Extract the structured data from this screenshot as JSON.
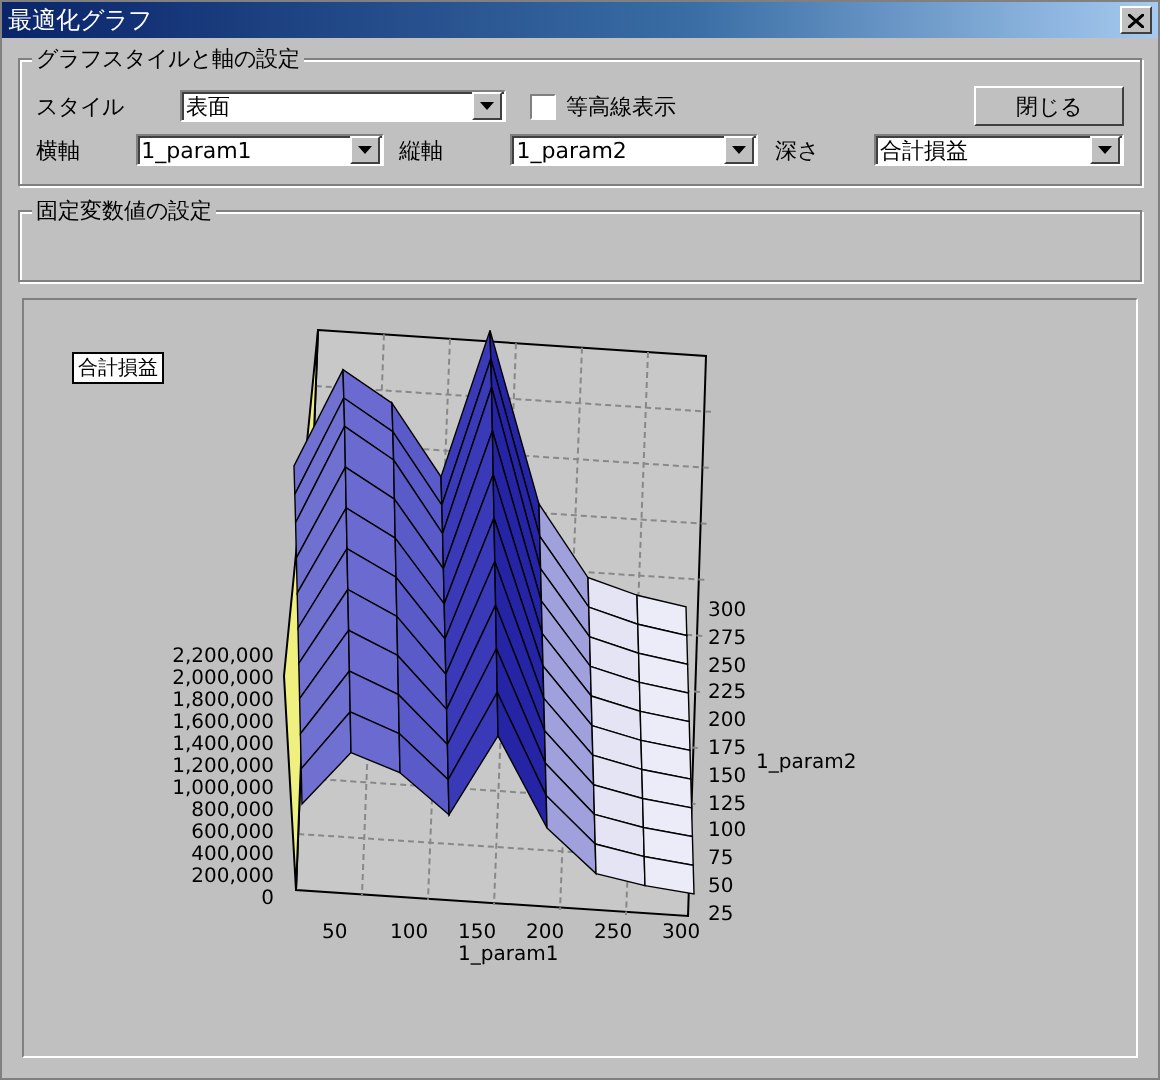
{
  "window": {
    "title": "最適化グラフ"
  },
  "axis_group": {
    "title": "グラフスタイルと軸の設定",
    "style": {
      "label": "スタイル",
      "value": "表面"
    },
    "contour": {
      "label": "等高線表示",
      "checked": false
    },
    "close_button": "閉じる",
    "x_axis": {
      "label": "横軸",
      "value": "1_param1"
    },
    "y_axis": {
      "label": "縦軸",
      "value": "1_param2"
    },
    "depth": {
      "label": "深さ",
      "value": "合計損益"
    }
  },
  "fixed_group": {
    "title": "固定変数値の設定"
  },
  "plot": {
    "legend": "合計損益",
    "z_ticks": [
      "2,200,000",
      "2,000,000",
      "1,800,000",
      "1,600,000",
      "1,400,000",
      "1,200,000",
      "1,000,000",
      "800,000",
      "600,000",
      "400,000",
      "200,000",
      "0"
    ],
    "x_ticks": [
      "50",
      "100",
      "150",
      "200",
      "250",
      "300"
    ],
    "xlabel": "1_param1",
    "y_ticks": [
      "300",
      "275",
      "250",
      "225",
      "200",
      "175",
      "150",
      "125",
      "100",
      "75",
      "50",
      "25"
    ],
    "ylabel": "1_param2"
  }
}
